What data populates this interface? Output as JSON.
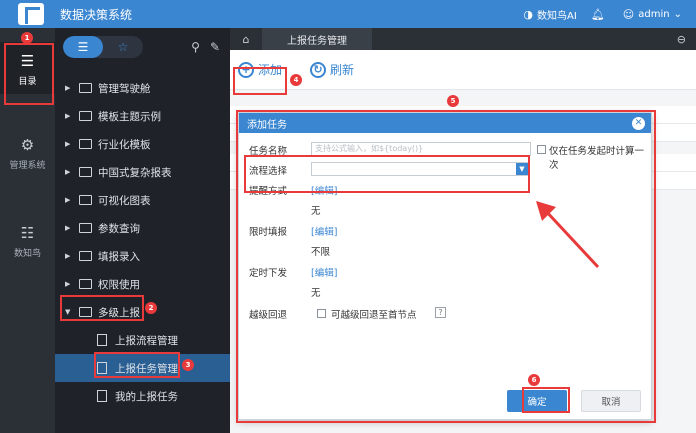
{
  "app": {
    "title": "数据决策系统"
  },
  "topbar": {
    "assistant": "数知鸟AI",
    "user": "admin"
  },
  "leftnav": [
    {
      "label": "目录",
      "icon": "list-icon",
      "active": true
    },
    {
      "label": "管理系统",
      "icon": "gear-icon",
      "active": false
    },
    {
      "label": "数知鸟",
      "icon": "bird-icon",
      "active": false
    }
  ],
  "tree": {
    "items": [
      {
        "label": "管理驾驶舱",
        "type": "folder"
      },
      {
        "label": "模板主题示例",
        "type": "folder"
      },
      {
        "label": "行业化模板",
        "type": "folder"
      },
      {
        "label": "中国式复杂报表",
        "type": "folder"
      },
      {
        "label": "可视化图表",
        "type": "folder"
      },
      {
        "label": "参数查询",
        "type": "folder"
      },
      {
        "label": "填报录入",
        "type": "folder"
      },
      {
        "label": "权限使用",
        "type": "folder"
      },
      {
        "label": "多级上报",
        "type": "folder",
        "expanded": true
      },
      {
        "label": "上报流程管理",
        "type": "doc"
      },
      {
        "label": "上报任务管理",
        "type": "doc",
        "selected": true
      },
      {
        "label": "我的上报任务",
        "type": "doc"
      }
    ]
  },
  "tabs": {
    "active": "上报任务管理"
  },
  "toolbar": {
    "add": "添加",
    "refresh": "刷新"
  },
  "dialog": {
    "title": "添加任务",
    "fields": {
      "task_name_label": "任务名称",
      "task_name_placeholder": "支持公式输入，如${today()}",
      "only_on_trigger_label": "仅在任务发起时计算一次",
      "flow_label": "流程选择",
      "remind_label": "提醒方式",
      "remind_edit": "[编辑]",
      "remind_value": "无",
      "deadline_label": "限时填报",
      "deadline_edit": "[编辑]",
      "deadline_value": "不限",
      "schedule_label": "定时下发",
      "schedule_edit": "[编辑]",
      "schedule_value": "无",
      "rollback_label": "越级回退",
      "rollback_option": "可越级回退至首节点",
      "help": "?"
    },
    "ok": "确定",
    "cancel": "取消"
  },
  "annotations": {
    "b1": "1",
    "b2": "2",
    "b3": "3",
    "b4": "4",
    "b5": "5",
    "b6": "6"
  },
  "colors": {
    "accent": "#3a86d1",
    "highlight": "#e83a3a",
    "sidebar": "#2b3036"
  }
}
